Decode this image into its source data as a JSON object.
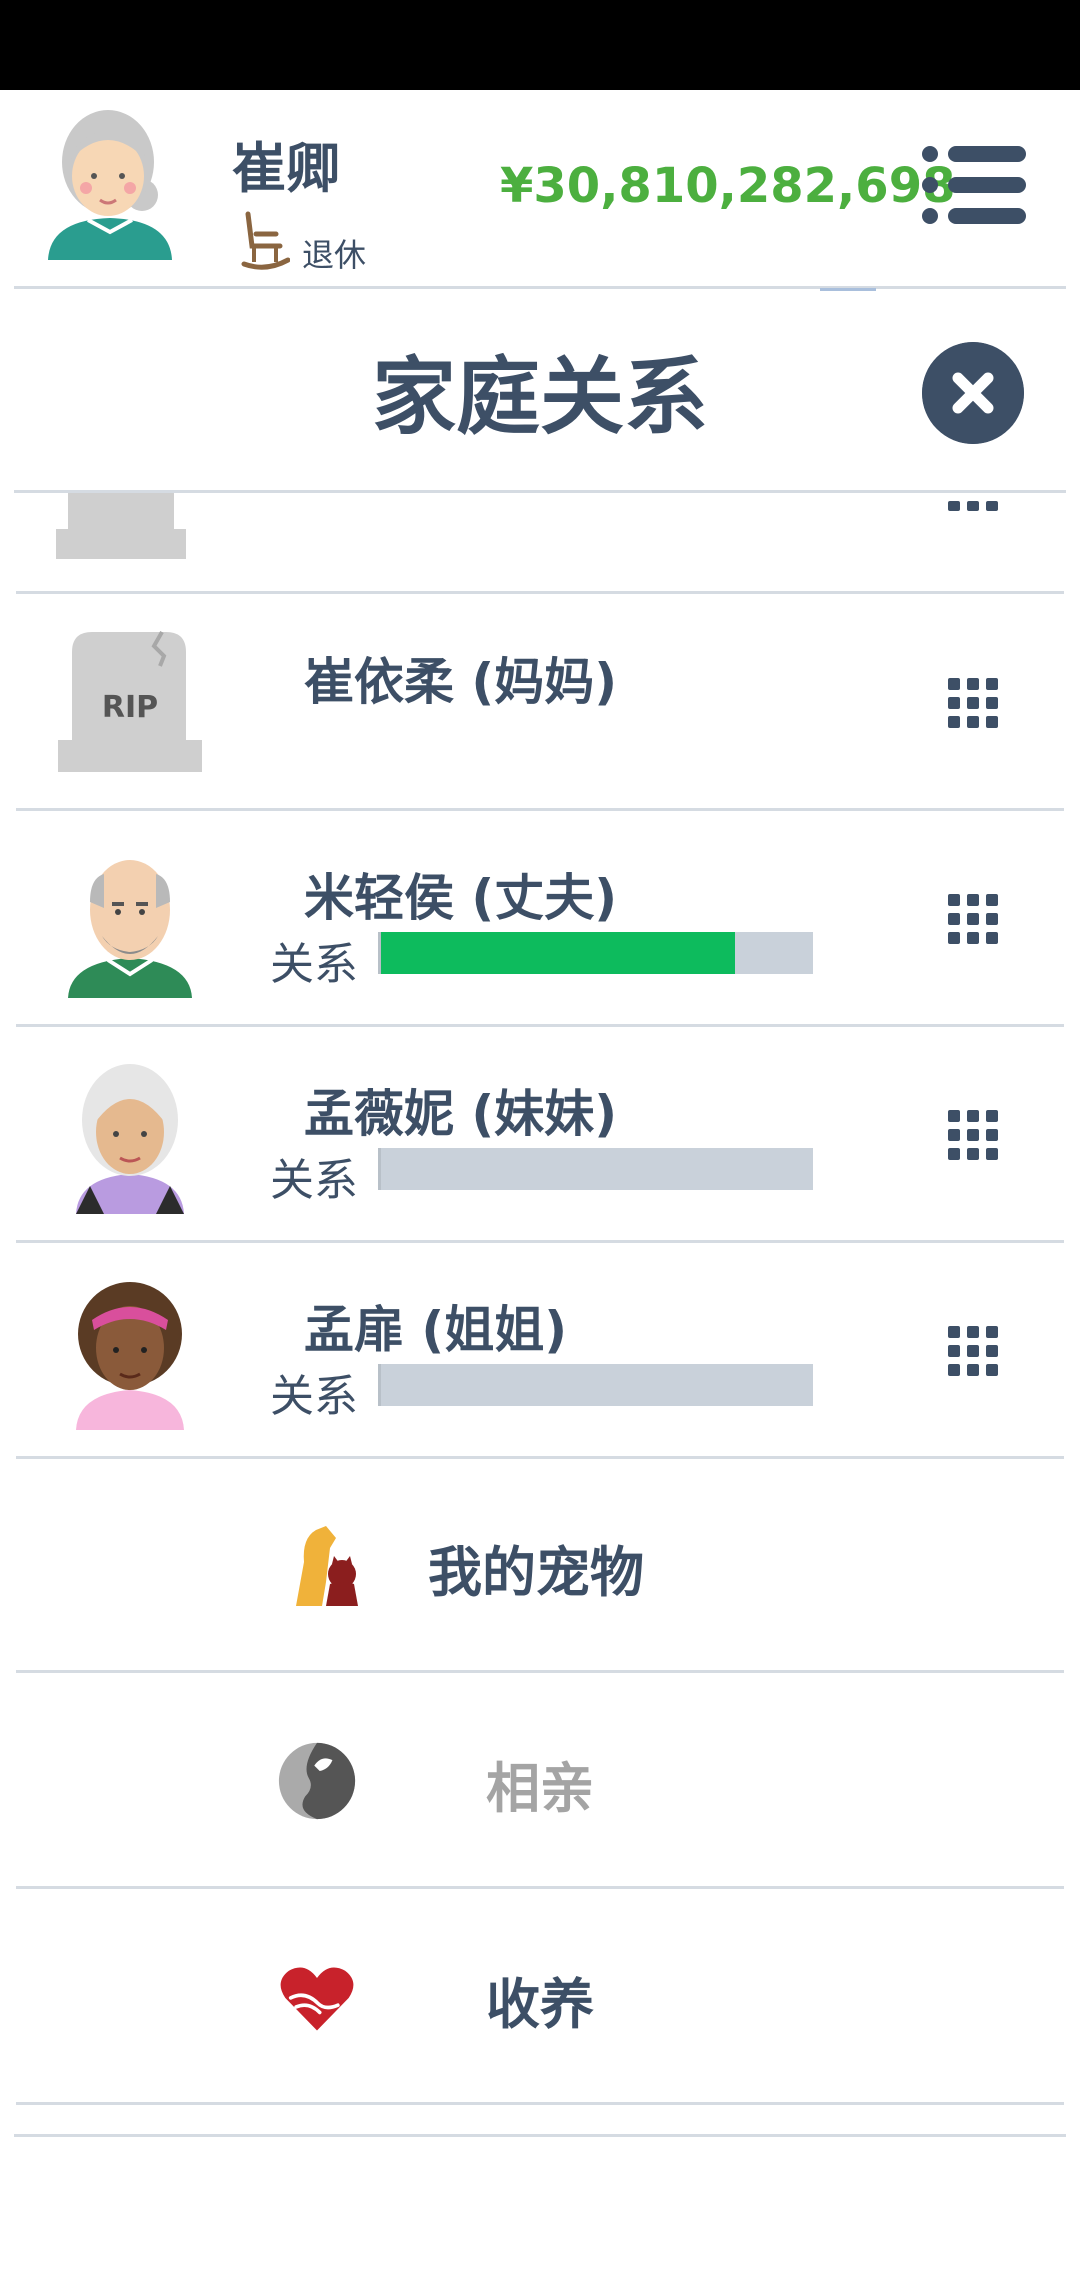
{
  "character": {
    "name": "崔卿",
    "status": "退休",
    "money": "¥30,810,282,698"
  },
  "dialog": {
    "title": "家庭关系"
  },
  "family": [
    {
      "name": "崔依柔 (妈妈)",
      "deceased": true,
      "tombstone_text": "RIP"
    },
    {
      "name": "米轻侯 (丈夫)",
      "relation_label": "关系",
      "relation_level": 0.82
    },
    {
      "name": "孟薇妮 (妹妹)",
      "relation_label": "关系",
      "relation_level": 0.0
    },
    {
      "name": "孟扉 (姐姐)",
      "relation_label": "关系",
      "relation_level": 0.0
    }
  ],
  "menu": [
    {
      "label": "我的宠物",
      "icon": "pets-icon",
      "enabled": true
    },
    {
      "label": "相亲",
      "icon": "dating-icon",
      "enabled": false
    },
    {
      "label": "收养",
      "icon": "adoption-icon",
      "enabled": true
    }
  ],
  "colors": {
    "text": "#3d4f66",
    "money": "#4caf3f",
    "relation_fill": "#0dbb5d",
    "relation_track": "#c9d1da",
    "divider": "#d5dbe2"
  }
}
